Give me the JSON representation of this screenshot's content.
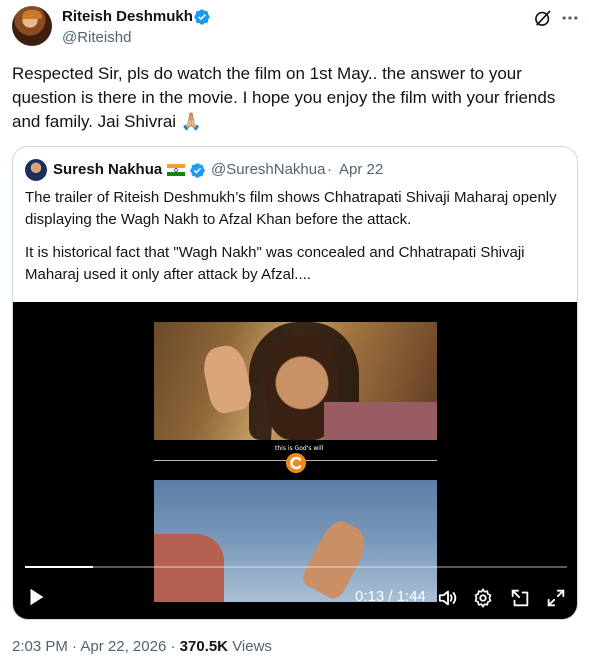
{
  "author": {
    "name": "Riteish Deshmukh",
    "handle": "@Riteishd"
  },
  "tweet": {
    "text": "Respected Sir, pls do watch the film on 1st May.. the answer to your question is there in the movie. I hope you enjoy the film with your friends and family.  Jai Shivrai 🙏🏼"
  },
  "quote": {
    "name": "Suresh Nakhua",
    "handle": "@SureshNakhua",
    "separator": "·",
    "date": "Apr 22",
    "paragraphs": [
      "The trailer of Riteish Deshmukh’s film shows Chhatrapati Shivaji Maharaj openly displaying the Wagh Nakh to Afzal Khan before the attack.",
      "It is historical fact that \"Wagh Nakh\" was concealed and Chhatrapati Shivaji Maharaj used it only after attack by Afzal...."
    ],
    "video": {
      "caption": "this is God's will",
      "time": "0:13 / 1:44",
      "progress": 0.125
    }
  },
  "meta": {
    "time": "2:03 PM",
    "separator1": "·",
    "date": "Apr 22, 2026",
    "separator2": "·",
    "views_count": "370.5K",
    "views_label": "Views"
  },
  "colors": {
    "verified": "#1d9bf0",
    "secondary_text": "#536471",
    "border": "#cfd9de",
    "logo_orange": "#f28a1b"
  }
}
